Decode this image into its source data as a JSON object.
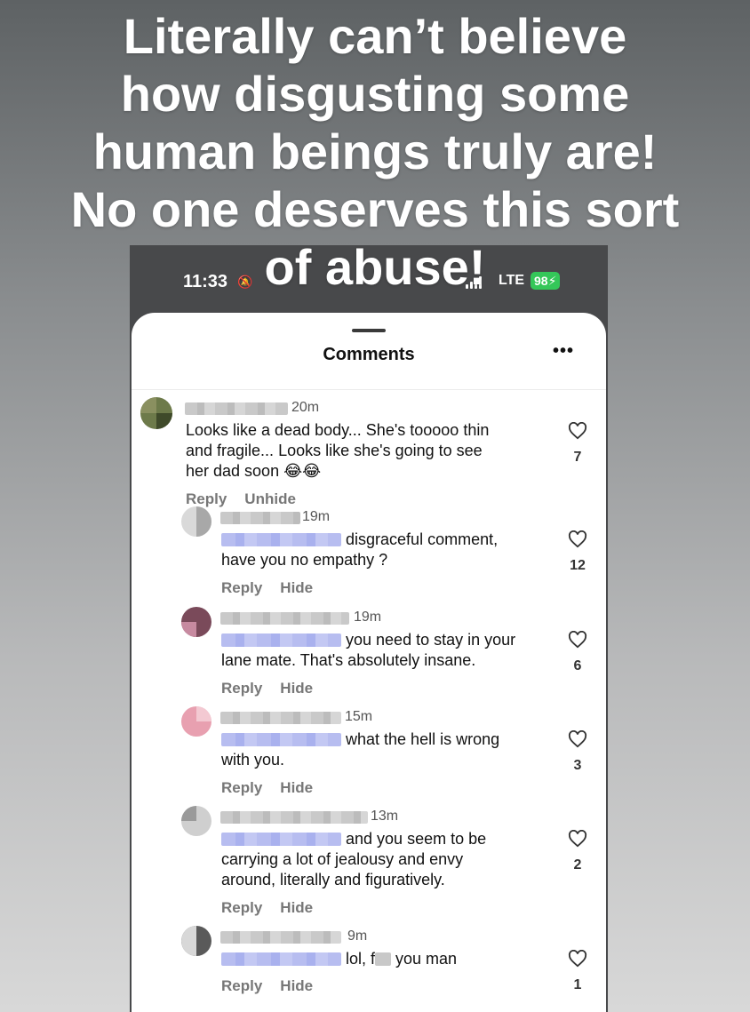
{
  "headline": {
    "lines": [
      "Literally can’t believe",
      "how disgusting some",
      "human beings truly are!",
      "No one deserves this sort",
      "of abuse!"
    ]
  },
  "status_bar": {
    "time": "11:33",
    "network": "LTE",
    "battery": "98"
  },
  "sheet": {
    "title": "Comments",
    "more_icon": "•••"
  },
  "comments": [
    {
      "time": "20m",
      "text": "Looks like a dead body... She's tooooo thin\nand fragile... Looks like she's going to see\nher dad soon 😂😂",
      "actions": [
        "Reply",
        "Unhide"
      ],
      "likes": "7"
    },
    {
      "time": "19m",
      "text_first": "disgraceful comment,",
      "text_rest": "have you no empathy ?",
      "actions": [
        "Reply",
        "Hide"
      ],
      "likes": "12"
    },
    {
      "time": "19m",
      "text_first": "you need to stay in your",
      "text_rest": "lane mate. That's absolutely insane.",
      "actions": [
        "Reply",
        "Hide"
      ],
      "likes": "6"
    },
    {
      "time": "15m",
      "text_first": "what the hell is wrong",
      "text_rest": "with you.",
      "actions": [
        "Reply",
        "Hide"
      ],
      "likes": "3"
    },
    {
      "time": "13m",
      "text_first": "and you seem to be",
      "text_rest": "carrying a lot of jealousy and envy\naround, literally and figuratively.",
      "actions": [
        "Reply",
        "Hide"
      ],
      "likes": "2"
    },
    {
      "time": "9m",
      "text_first": "lol, f",
      "text_after_censor": " you man",
      "actions": [
        "Reply",
        "Hide"
      ],
      "likes": "1"
    }
  ],
  "colors": {
    "battery_green": "#34c759",
    "mention_blur": "#b7bdf0"
  }
}
